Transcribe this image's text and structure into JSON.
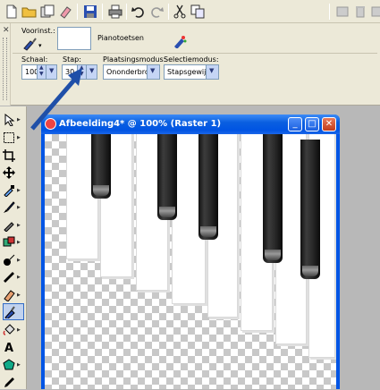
{
  "toolbar": {
    "left_icons": [
      "new-document-icon",
      "open-folder-icon",
      "browse-icon",
      "eraser-icon",
      "save-icon",
      "print-icon",
      "undo-icon",
      "redo-icon",
      "cut-icon",
      "copy-icon"
    ],
    "right_icons": [
      "layer-new-icon",
      "layer-delete-icon",
      "layer-copy-icon",
      "layer-properties-icon"
    ]
  },
  "tool_options": {
    "preset_label": "Voorinst.:",
    "preset_name": "Pianotoetsen",
    "scale_label": "Schaal:",
    "scale_value": "100",
    "step_label": "Stap:",
    "step_value": "30",
    "placement_label": "Plaatsingsmodus:",
    "placement_value": "Ononderbrok",
    "selection_label": "Selectiemodus:",
    "selection_value": "Stapsgewijs"
  },
  "tools": [
    "pointer-tool-icon",
    "selection-tool-icon",
    "crop-tool-icon",
    "move-tool-icon",
    "eyedropper-tool-icon",
    "paint-brush-tool-icon",
    "clone-brush-tool-icon",
    "scratch-remover-tool-icon",
    "dodge-tool-icon",
    "smudge-tool-icon",
    "eraser-tool-icon",
    "picture-tube-tool-icon",
    "flood-fill-tool-icon",
    "text-tool-icon",
    "preset-shape-tool-icon",
    "pen-tool-icon"
  ],
  "document": {
    "title": "Afbeelding4* @ 100% (Raster 1)"
  },
  "colors": {
    "titlebar": "#0054e3",
    "annotation_arrow": "#1f4fa8",
    "panel_bg": "#ece9d8"
  }
}
